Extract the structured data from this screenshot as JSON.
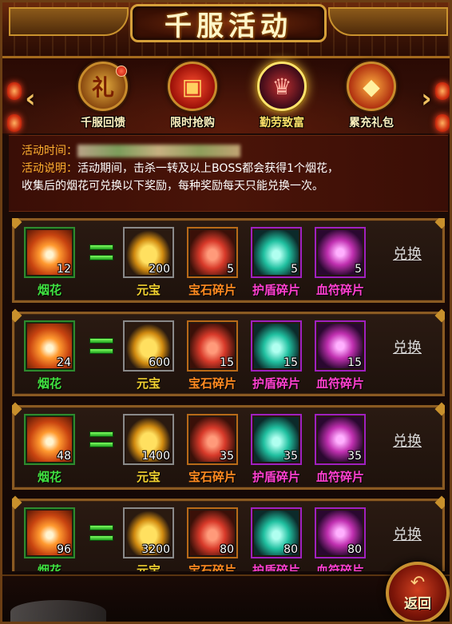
{
  "header": {
    "title": "千服活动"
  },
  "tabs": [
    {
      "label": "千服回馈",
      "icon": "gift-bag-icon",
      "badge": true,
      "active": false
    },
    {
      "label": "限时抢购",
      "icon": "gift-box-clock-icon",
      "badge": false,
      "active": false
    },
    {
      "label": "勤劳致富",
      "icon": "demon-mask-icon",
      "badge": false,
      "active": true
    },
    {
      "label": "累充礼包",
      "icon": "treasure-sack-icon",
      "badge": false,
      "active": false
    }
  ],
  "info": {
    "time_label": "活动时间：",
    "desc_label": "活动说明：",
    "desc_text": "活动期间，击杀一转及以上BOSS都会获得1个烟花，",
    "desc_text2": "收集后的烟花可兑换以下奖励，每种奖励每天只能兑换一次。"
  },
  "rows": [
    {
      "cost_name": "烟花",
      "cost_qty": "12",
      "rewards": [
        {
          "name": "元宝",
          "qty": "200"
        },
        {
          "name": "宝石碎片",
          "qty": "5"
        },
        {
          "name": "护盾碎片",
          "qty": "5"
        },
        {
          "name": "血符碎片",
          "qty": "5"
        }
      ],
      "action": "兑换"
    },
    {
      "cost_name": "烟花",
      "cost_qty": "24",
      "rewards": [
        {
          "name": "元宝",
          "qty": "600"
        },
        {
          "name": "宝石碎片",
          "qty": "15"
        },
        {
          "name": "护盾碎片",
          "qty": "15"
        },
        {
          "name": "血符碎片",
          "qty": "15"
        }
      ],
      "action": "兑换"
    },
    {
      "cost_name": "烟花",
      "cost_qty": "48",
      "rewards": [
        {
          "name": "元宝",
          "qty": "1400"
        },
        {
          "name": "宝石碎片",
          "qty": "35"
        },
        {
          "name": "护盾碎片",
          "qty": "35"
        },
        {
          "name": "血符碎片",
          "qty": "35"
        }
      ],
      "action": "兑换"
    },
    {
      "cost_name": "烟花",
      "cost_qty": "96",
      "rewards": [
        {
          "name": "元宝",
          "qty": "3200"
        },
        {
          "name": "宝石碎片",
          "qty": "80"
        },
        {
          "name": "护盾碎片",
          "qty": "80"
        },
        {
          "name": "血符碎片",
          "qty": "80"
        }
      ],
      "action": "兑换"
    }
  ],
  "footer": {
    "return_label": "返回"
  },
  "colors": {
    "item_green": "#40e040",
    "item_yellow": "#f0d030",
    "item_orange": "#ff8a20",
    "item_magenta": "#ff40d0"
  }
}
